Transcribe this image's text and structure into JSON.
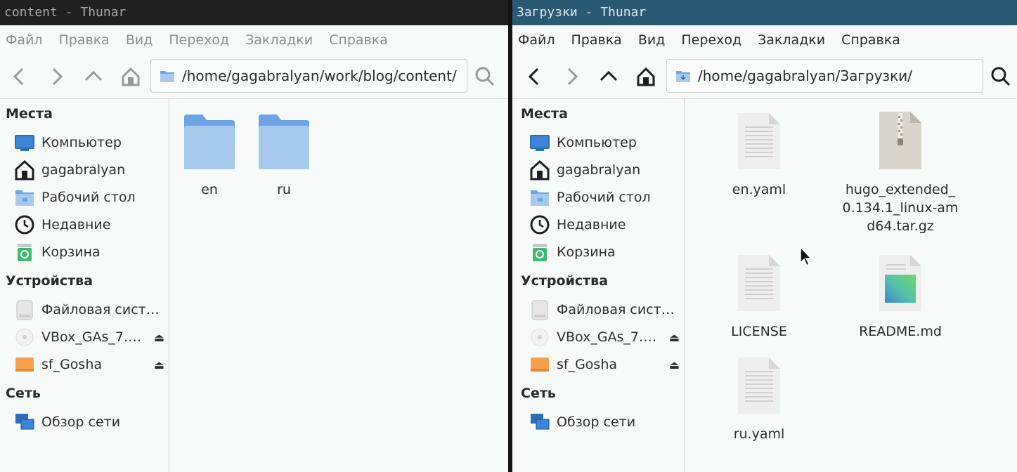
{
  "left": {
    "title": "content - Thunar",
    "menu": [
      "Файл",
      "Правка",
      "Вид",
      "Переход",
      "Закладки",
      "Справка"
    ],
    "address": "/home/gagabralyan/work/blog/content/",
    "sidebar": {
      "places_header": "Места",
      "places": [
        {
          "label": "Компьютер",
          "icon": "computer-icon"
        },
        {
          "label": "gagabralyan",
          "icon": "home-icon"
        },
        {
          "label": "Рабочий стол",
          "icon": "desktop-folder-icon"
        },
        {
          "label": "Недавние",
          "icon": "clock-icon"
        },
        {
          "label": "Корзина",
          "icon": "trash-icon"
        }
      ],
      "devices_header": "Устройства",
      "devices": [
        {
          "label": "Файловая систе…",
          "icon": "drive-icon"
        },
        {
          "label": "VBox_GAs_7.…",
          "icon": "disc-icon"
        },
        {
          "label": "sf_Gosha",
          "icon": "shared-drive-icon"
        }
      ],
      "network_header": "Сеть",
      "network": [
        {
          "label": "Обзор сети",
          "icon": "network-icon"
        }
      ]
    },
    "files": [
      {
        "name": "en",
        "type": "folder"
      },
      {
        "name": "ru",
        "type": "folder"
      }
    ]
  },
  "right": {
    "title": "Загрузки - Thunar",
    "menu": [
      "Файл",
      "Правка",
      "Вид",
      "Переход",
      "Закладки",
      "Справка"
    ],
    "address": "/home/gagabralyan/Загрузки/",
    "sidebar": {
      "places_header": "Места",
      "places": [
        {
          "label": "Компьютер",
          "icon": "computer-icon"
        },
        {
          "label": "gagabralyan",
          "icon": "home-icon"
        },
        {
          "label": "Рабочий стол",
          "icon": "desktop-folder-icon"
        },
        {
          "label": "Недавние",
          "icon": "clock-icon"
        },
        {
          "label": "Корзина",
          "icon": "trash-icon"
        }
      ],
      "devices_header": "Устройства",
      "devices": [
        {
          "label": "Файловая сист…",
          "icon": "drive-icon"
        },
        {
          "label": "VBox_GAs_7.…",
          "icon": "disc-icon"
        },
        {
          "label": "sf_Gosha",
          "icon": "shared-drive-icon"
        }
      ],
      "network_header": "Сеть",
      "network": [
        {
          "label": "Обзор сети",
          "icon": "network-icon"
        }
      ]
    },
    "files": [
      {
        "name": "en.yaml",
        "type": "text"
      },
      {
        "name": "hugo_extended_0.134.1_linux-amd64.tar.gz",
        "type": "archive"
      },
      {
        "name": "LICENSE",
        "type": "text"
      },
      {
        "name": "README.md",
        "type": "markdown"
      },
      {
        "name": "ru.yaml",
        "type": "text"
      }
    ]
  },
  "colors": {
    "folder": "#6ea4e6",
    "folder_light": "#a6c9ec",
    "active_title": "#2a5a73",
    "inactive_title": "#202020"
  }
}
